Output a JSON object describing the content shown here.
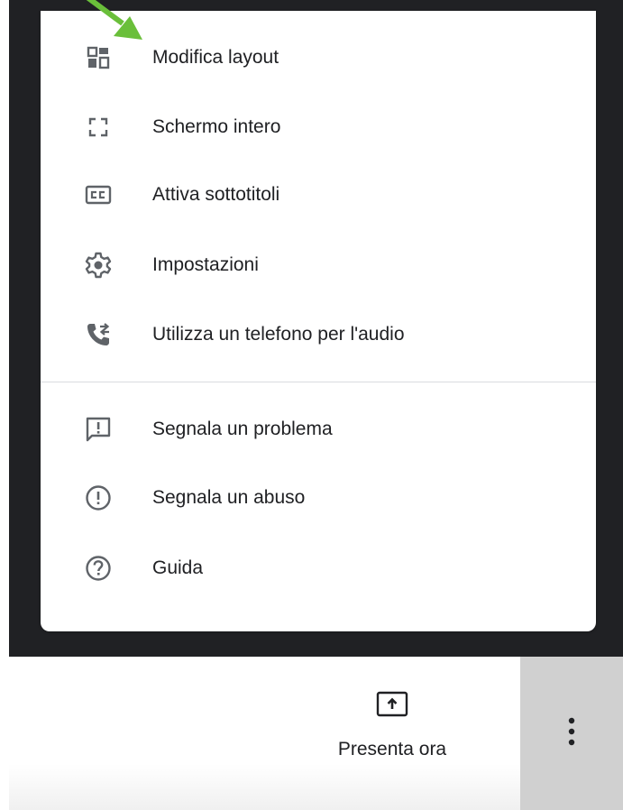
{
  "menu": {
    "items": [
      {
        "label": "Modifica layout",
        "icon": "layout-icon"
      },
      {
        "label": "Schermo intero",
        "icon": "fullscreen-icon"
      },
      {
        "label": "Attiva sottotitoli",
        "icon": "closed-captions-icon"
      },
      {
        "label": "Impostazioni",
        "icon": "gear-icon"
      },
      {
        "label": "Utilizza un telefono per l'audio",
        "icon": "phone-transfer-icon"
      },
      {
        "label": "Segnala un problema",
        "icon": "feedback-icon"
      },
      {
        "label": "Segnala un abuso",
        "icon": "alert-circle-icon"
      },
      {
        "label": "Guida",
        "icon": "help-circle-icon"
      }
    ]
  },
  "toolbar": {
    "present_label": "Presenta ora",
    "present_icon": "present-screen-icon",
    "more_icon": "more-vertical-icon"
  },
  "annotation": {
    "arrow_color": "#6abf3a"
  },
  "colors": {
    "icon": "#5f6368",
    "text": "#202124",
    "backdrop": "#202124",
    "more_button_bg": "#d0d0d0"
  }
}
